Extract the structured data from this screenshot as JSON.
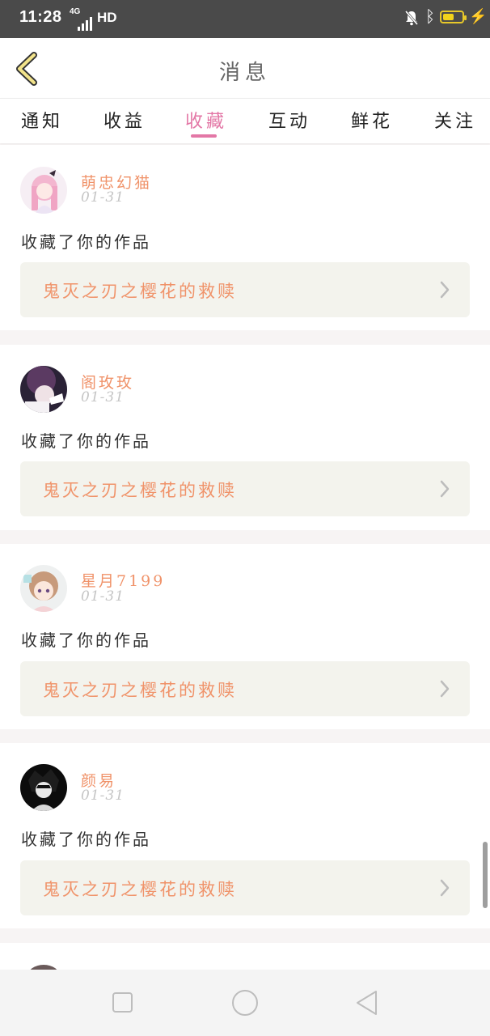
{
  "status_bar": {
    "time": "11:28",
    "network": "4G",
    "hd": "HD"
  },
  "header": {
    "back_icon": "chevron-left-icon",
    "title": "消息"
  },
  "tabs": [
    {
      "label": "通知"
    },
    {
      "label": "收益"
    },
    {
      "label": "收藏",
      "active": true
    },
    {
      "label": "互动"
    },
    {
      "label": "鲜花"
    },
    {
      "label": "关注"
    }
  ],
  "messages": [
    {
      "name": "萌忠幻猫",
      "date": "01-31",
      "action": "收藏了你的作品",
      "work": "鬼灭之刃之樱花的救赎"
    },
    {
      "name": "阁玫玫",
      "date": "01-31",
      "action": "收藏了你的作品",
      "work": "鬼灭之刃之樱花的救赎"
    },
    {
      "name": "星月7199",
      "date": "01-31",
      "action": "收藏了你的作品",
      "work": "鬼灭之刃之樱花的救赎"
    },
    {
      "name": "颜易",
      "date": "01-31",
      "action": "收藏了你的作品",
      "work": "鬼灭之刃之樱花的救赎"
    }
  ],
  "colors": {
    "accent_pink": "#e377a6",
    "name_orange": "#f0936a",
    "card_bg": "#f3f3ed",
    "status_bar": "#4a4a4a"
  },
  "nav_bar": {
    "icons": [
      "square-icon",
      "circle-home-icon",
      "triangle-back-icon"
    ]
  }
}
